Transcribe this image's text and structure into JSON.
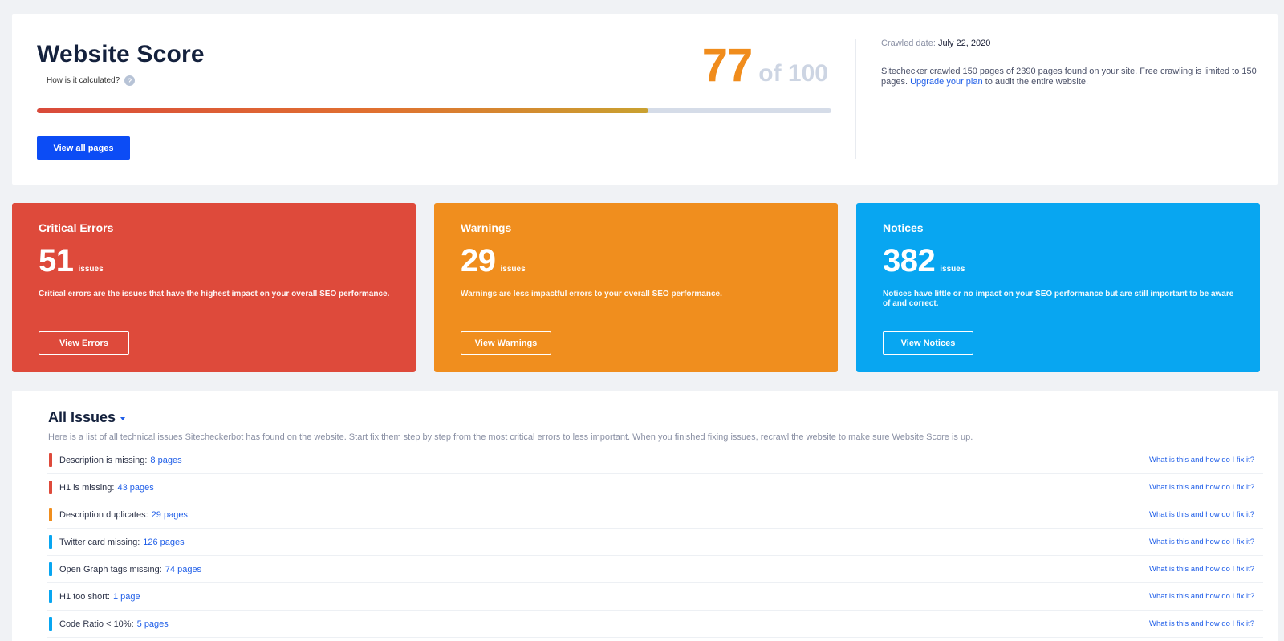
{
  "score": {
    "title": "Website Score",
    "how_calculated": "How is it calculated?",
    "help_glyph": "?",
    "value": "77",
    "of": "of 100",
    "progress_fraction": 0.77,
    "view_all_label": "View all pages",
    "crawled_date_label": "Crawled date:",
    "crawled_date": "July 22, 2020",
    "crawl_desc_prefix": "Sitechecker crawled 150 pages of 2390 pages found on your site. Free crawling is limited to 150 pages.",
    "upgrade_link": "Upgrade your plan",
    "crawl_desc_suffix": "to audit the entire website."
  },
  "categories": {
    "errors": {
      "title": "Critical Errors",
      "count": "51",
      "issues_word": "issues",
      "description": "Critical errors are the issues that have the highest impact on your overall SEO performance.",
      "button": "View Errors",
      "color": "#de4a3b"
    },
    "warnings": {
      "title": "Warnings",
      "count": "29",
      "issues_word": "issues",
      "description": "Warnings are less impactful errors to your overall SEO performance.",
      "button": "View Warnings",
      "color": "#f08e1e"
    },
    "notices": {
      "title": "Notices",
      "count": "382",
      "issues_word": "issues",
      "description": "Notices have little or no impact on your SEO performance but are still important to be aware of and correct.",
      "button": "View Notices",
      "color": "#08a6f1"
    }
  },
  "all_issues": {
    "title": "All Issues",
    "description": "Here is a list of all technical issues Sitecheckerbot has found on the website. Start fix them step by step from the most critical errors to less important. When you finished fixing issues, recrawl the website to make sure Website Score is up.",
    "help_text": "What is this and how do I fix it?",
    "items": [
      {
        "label": "Description is missing:",
        "pages": "8 pages",
        "severity_color": "#de4a3b"
      },
      {
        "label": "H1 is missing:",
        "pages": "43 pages",
        "severity_color": "#de4a3b"
      },
      {
        "label": "Description duplicates:",
        "pages": "29 pages",
        "severity_color": "#f08e1e"
      },
      {
        "label": "Twitter card missing:",
        "pages": "126 pages",
        "severity_color": "#08a6f1"
      },
      {
        "label": "Open Graph tags missing:",
        "pages": "74 pages",
        "severity_color": "#08a6f1"
      },
      {
        "label": "H1 too short:",
        "pages": "1 page",
        "severity_color": "#08a6f1"
      },
      {
        "label": "Code Ratio < 10%:",
        "pages": "5 pages",
        "severity_color": "#08a6f1"
      }
    ]
  }
}
